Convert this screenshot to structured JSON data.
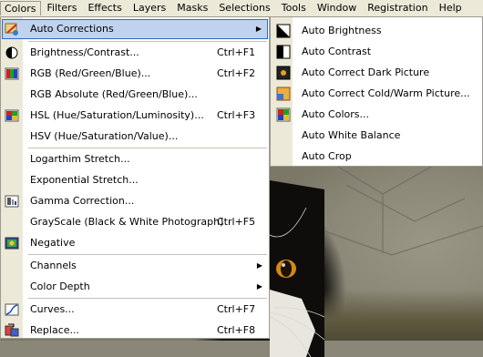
{
  "menubar": [
    "Colors",
    "Filters",
    "Effects",
    "Layers",
    "Masks",
    "Selections",
    "Tools",
    "Window",
    "Registration",
    "Help"
  ],
  "colors_menu": {
    "auto_corrections": "Auto Corrections",
    "brightness_contrast": {
      "label": "Brightness/Contrast...",
      "shortcut": "Ctrl+F1"
    },
    "rgb": {
      "label": "RGB  (Red/Green/Blue)...",
      "shortcut": "Ctrl+F2"
    },
    "rgb_absolute": "RGB Absolute (Red/Green/Blue)...",
    "hsl": {
      "label": "HSL (Hue/Saturation/Luminosity)...",
      "shortcut": "Ctrl+F3"
    },
    "hsv": "HSV (Hue/Saturation/Value)...",
    "logarithm_stretch": "Logarthim Stretch...",
    "exponential_stretch": "Exponential Stretch...",
    "gamma_correction": "Gamma Correction...",
    "grayscale": {
      "label": "GrayScale (Black & White Photograph)",
      "shortcut": "Ctrl+F5"
    },
    "negative": "Negative",
    "channels": "Channels",
    "color_depth": "Color Depth",
    "curves": {
      "label": "Curves...",
      "shortcut": "Ctrl+F7"
    },
    "replace": {
      "label": "Replace...",
      "shortcut": "Ctrl+F8"
    }
  },
  "auto_submenu": {
    "auto_brightness": "Auto Brightness",
    "auto_contrast": "Auto Contrast",
    "auto_correct_dark": "Auto Correct Dark Picture",
    "auto_correct_cold_warm": "Auto Correct Cold/Warm Picture...",
    "auto_colors": "Auto Colors...",
    "auto_white_balance": "Auto White Balance",
    "auto_crop": "Auto Crop"
  },
  "colors": {
    "highlight_bg": "#c1d2ee",
    "highlight_border": "#316ac5",
    "gutter": "#ece9d8"
  }
}
